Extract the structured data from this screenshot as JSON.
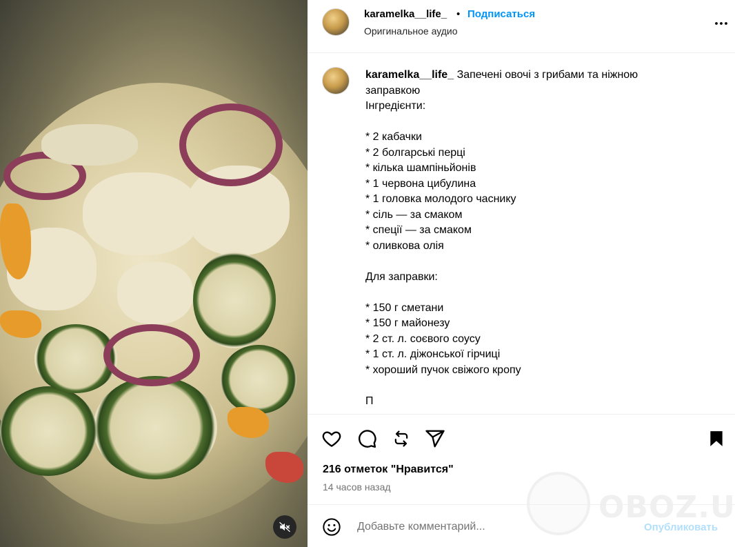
{
  "post": {
    "username": "karamelka__life_",
    "separator": "•",
    "follow_label": "Подписаться",
    "audio_label": "Оригинальное аудио",
    "caption_title": "Запечені овочі з грибами та ніжною заправкою",
    "caption_body": "\nІнгредієнти:\n\n* 2 кабачки\n* 2 болгарські перці\n* кілька шампіньйонів\n* 1 червона цибулина\n* 1 головка молодого часнику\n* сіль — за смаком\n* спеції — за смаком\n* оливкова олія\n\nДля заправки:\n\n* 150 г сметани\n* 150 г майонезу\n* 2 ст. л. соєвого соусу\n* 1 ст. л. діжонської гірчиці\n* хороший пучок свіжого кропу\n\nП",
    "likes_label": "216 отметок \"Нравится\"",
    "time_label": "14 часов назад"
  },
  "comment": {
    "placeholder": "Добавьте комментарий...",
    "post_label": "Опубликовать"
  },
  "watermark": {
    "text": "OBOZ.UA"
  },
  "icons": {
    "more": "more-options-icon",
    "like": "heart-icon",
    "comment": "comment-icon",
    "repost": "repost-icon",
    "share": "share-icon",
    "save": "bookmark-icon",
    "emoji": "emoji-icon",
    "mute": "audio-muted-icon"
  },
  "colors": {
    "accent": "#0095f6",
    "post_disabled": "#b2dffc",
    "muted_text": "#737373"
  }
}
